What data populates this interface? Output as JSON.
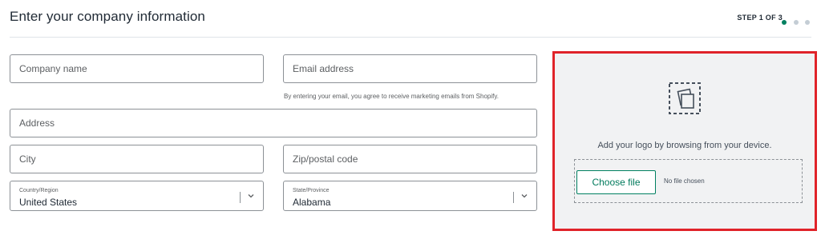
{
  "header": {
    "title": "Enter your company information",
    "step": "STEP 1 OF 3",
    "progress": {
      "current": 1,
      "total": 3
    }
  },
  "form": {
    "company_name": {
      "placeholder": "Company name",
      "value": ""
    },
    "email": {
      "placeholder": "Email address",
      "value": "",
      "hint": "By entering your email, you agree to receive marketing emails from Shopify."
    },
    "address": {
      "placeholder": "Address",
      "value": ""
    },
    "city": {
      "placeholder": "City",
      "value": ""
    },
    "zip": {
      "placeholder": "Zip/postal code",
      "value": ""
    },
    "country": {
      "label": "Country/Region",
      "value": "United States"
    },
    "state": {
      "label": "State/Province",
      "value": "Alabama"
    }
  },
  "logo_upload": {
    "prompt": "Add your logo by browsing from your device.",
    "button_label": "Choose file",
    "file_status": "No file chosen",
    "icon": "image-upload-icon"
  },
  "colors": {
    "accent": "#008060",
    "highlight_border": "#e02329",
    "panel_bg": "#f1f2f3"
  }
}
